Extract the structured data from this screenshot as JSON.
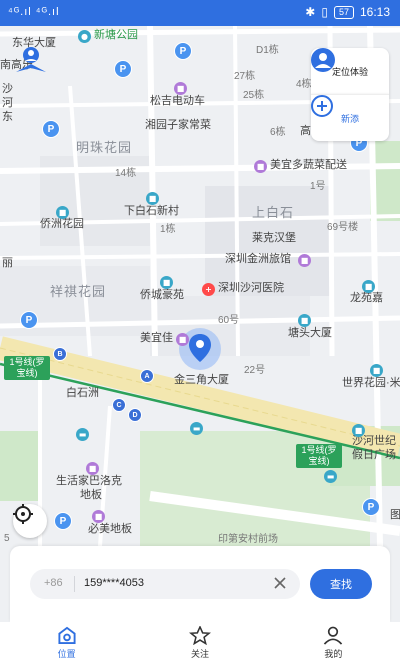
{
  "status_bar": {
    "signal": "⁴ᴳ.ıl ⁴ᴳ.ıl",
    "battery": "57",
    "time": "16:13"
  },
  "map": {
    "labels": {
      "dongdi": "东华大厦",
      "shenzhenkou": "南高乐",
      "xinzhou_park": "新塘公园",
      "d1": "D1栋",
      "b27": "27栋",
      "b4": "4栋",
      "b25": "25栋",
      "songji": "松吉电动车",
      "xiangyuan": "湘园子家常菜",
      "b6": "6栋",
      "gao": "高",
      "mingzhu": "明珠花园",
      "meiyi": "美宜多蔬菜配送",
      "b14": "14栋",
      "b1": "1号",
      "qiaozhou": "侨洲花园",
      "xiabaishi": "下白石新村",
      "shangbaishi": "上白石",
      "b69": "69号楼",
      "b1d": "1栋",
      "laike": "莱克汉堡",
      "jinzhou_hotel": "深圳金洲旅馆",
      "xiangqi": "祥祺花园",
      "qiaocheng": "侨城豪苑",
      "shahe_hospital": "深圳沙河医院",
      "longyuan": "龙苑嘉",
      "b60": "60号",
      "tangtou": "塘头大厦",
      "meiyijia": "美宜佳",
      "jinsanjiao": "金三角大厦",
      "b22": "22号",
      "world_garden": "世界花园·米",
      "baishizhou": "白石洲",
      "shahe_world": "沙河世纪",
      "holiday_plaza": "假日广场",
      "life_home": "生活家巴洛克",
      "life_home2": "地板",
      "bisu": "必美地板",
      "yinjin": "印第安村前场",
      "stub_dong": "东",
      "stub_sha": "沙",
      "stub_he": "河",
      "stub_li": "丽",
      "stub_tu": "图",
      "stub_5": "5"
    },
    "metro": {
      "tag1": "1号线(罗宝线)",
      "tag2": "1号线(罗宝线)"
    },
    "exits": [
      "B",
      "A",
      "C",
      "D"
    ]
  },
  "side_buttons": {
    "locate_label": "定位体验",
    "add_label": "新添"
  },
  "search": {
    "country_code": "+86",
    "phone_value": "159****4053",
    "button_label": "查找"
  },
  "tabs": [
    {
      "label": "位置"
    },
    {
      "label": "关注"
    },
    {
      "label": "我的"
    }
  ],
  "colors": {
    "accent": "#2f6fe0",
    "metro": "#2ca15a",
    "road": "#f5e9b0"
  }
}
